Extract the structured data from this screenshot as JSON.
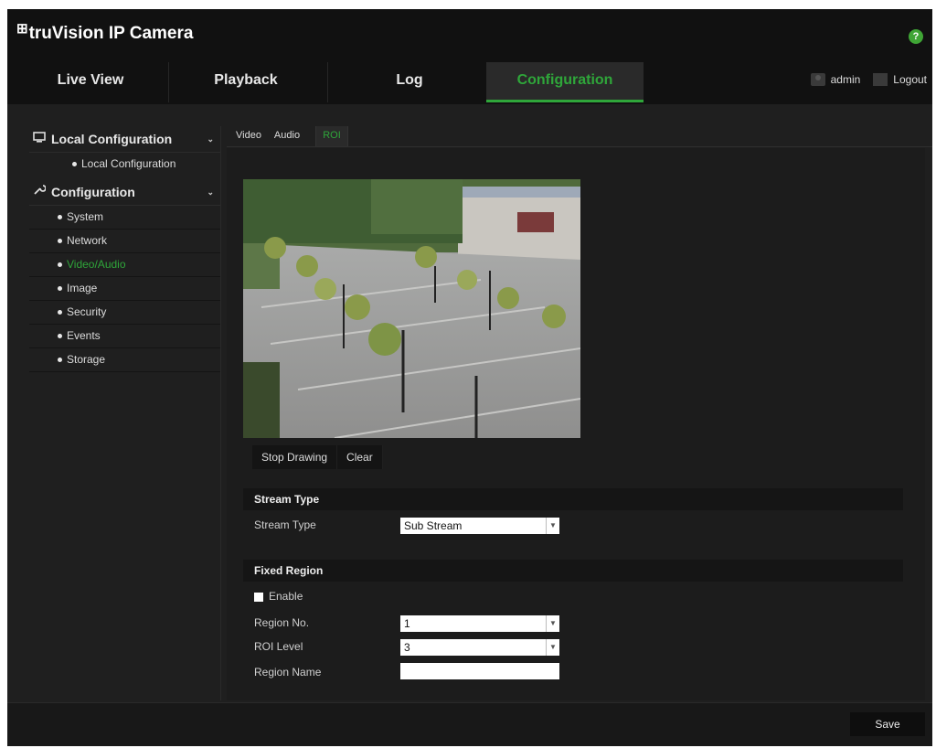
{
  "app": {
    "logo_mark": "⊞",
    "title": "truVision IP Camera",
    "help": "?"
  },
  "nav": {
    "tabs": [
      {
        "label": "Live View"
      },
      {
        "label": "Playback"
      },
      {
        "label": "Log"
      },
      {
        "label": "Configuration"
      }
    ],
    "active_tab": "Configuration",
    "user": "admin",
    "logout": "Logout"
  },
  "sidebar": {
    "local_configuration": {
      "label": "Local Configuration",
      "items": [
        "Local Configuration"
      ]
    },
    "configuration": {
      "label": "Configuration",
      "items": [
        "System",
        "Network",
        "Video/Audio",
        "Image",
        "Security",
        "Events",
        "Storage"
      ],
      "active": "Video/Audio"
    }
  },
  "subtabs": [
    "Video",
    "Audio",
    "ROI"
  ],
  "active_subtab": "ROI",
  "roi": {
    "stop_drawing": "Stop Drawing",
    "clear": "Clear",
    "stream_type_header": "Stream Type",
    "stream_type_label": "Stream Type",
    "stream_type_value": "Sub Stream",
    "fixed_region_header": "Fixed Region",
    "enable_label": "Enable",
    "region_no_label": "Region No.",
    "region_no_value": "1",
    "roi_level_label": "ROI Level",
    "roi_level_value": "3",
    "region_name_label": "Region Name",
    "region_name_value": ""
  },
  "footer": {
    "save": "Save"
  },
  "colors": {
    "accent": "#2fa63a",
    "background": "#1f1f1f",
    "header": "#111111"
  }
}
